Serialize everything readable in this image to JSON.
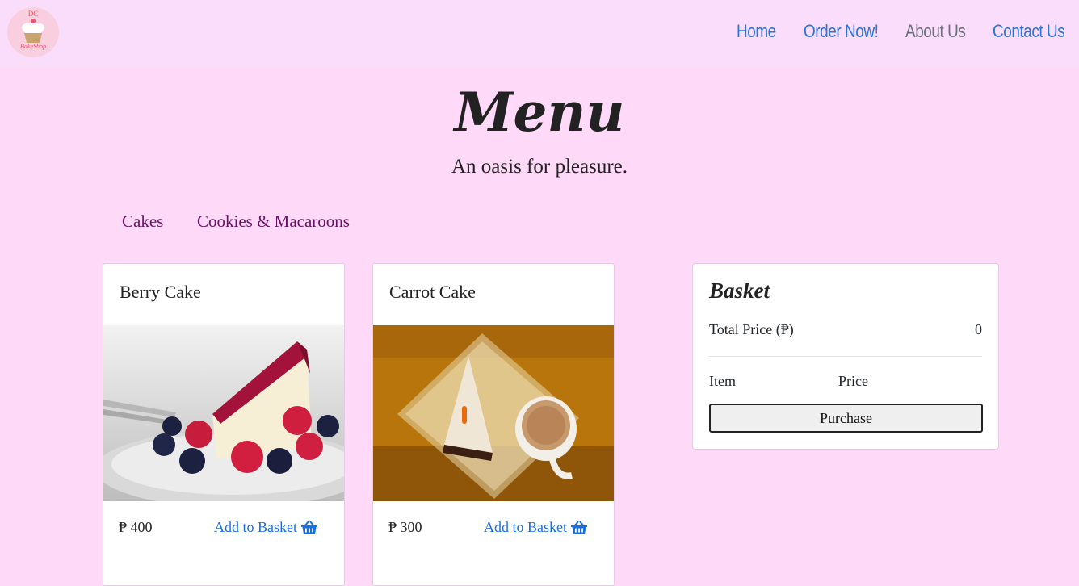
{
  "brand": {
    "logo_top_text": "DC",
    "logo_bottom_text": "BakeShop",
    "brand_color": "#e8546f"
  },
  "nav": {
    "items": [
      {
        "label": "Home"
      },
      {
        "label": "Order Now!"
      },
      {
        "label": "About Us"
      },
      {
        "label": "Contact Us"
      }
    ],
    "active": "About Us",
    "link_color": "#2a75d3"
  },
  "page": {
    "title": "Menu",
    "subtitle": "An oasis for pleasure.",
    "background": "#ffdaf8"
  },
  "categories": [
    {
      "label": "Cakes"
    },
    {
      "label": "Cookies & Macaroons"
    }
  ],
  "products": [
    {
      "name": "Berry Cake",
      "price": "₱ 400",
      "add_label": "Add to Basket",
      "icon": "basket-icon"
    },
    {
      "name": "Carrot Cake",
      "price": "₱ 300",
      "add_label": "Add to Basket",
      "icon": "basket-icon"
    }
  ],
  "basket": {
    "title": "Basket",
    "total_label": "Total Price (₱)",
    "total_value": "0",
    "col_item": "Item",
    "col_price": "Price",
    "purchase_label": "Purchase"
  }
}
